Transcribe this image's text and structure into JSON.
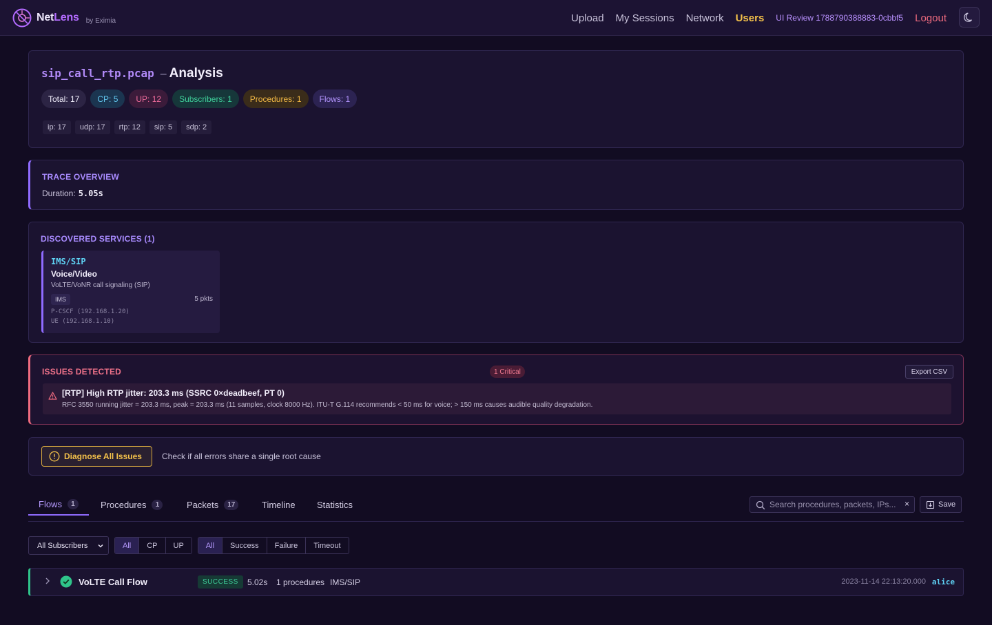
{
  "brand": {
    "name_part1": "Net",
    "name_part2": "Lens",
    "byline": "by Eximia"
  },
  "nav": {
    "links": [
      "Upload",
      "My Sessions",
      "Network",
      "Users"
    ],
    "active": "Users",
    "user": "UI Review 1788790388883-0cbbf5",
    "logout": "Logout",
    "theme_icon": "moon-icon"
  },
  "header": {
    "file_name": "sip_call_rtp.pcap",
    "separator": "–",
    "title_suffix": "Analysis",
    "chips": {
      "total": "Total: 17",
      "cp": "CP: 5",
      "up": "UP: 12",
      "subscribers": "Subscribers: 1",
      "procedures": "Procedures: 1",
      "flows": "Flows: 1"
    },
    "protocols": [
      "ip: 17",
      "udp: 17",
      "rtp: 12",
      "sip: 5",
      "sdp: 2"
    ]
  },
  "trace": {
    "title": "TRACE OVERVIEW",
    "duration_label": "Duration:",
    "duration_value": "5.05s"
  },
  "services": {
    "title": "DISCOVERED SERVICES (1)",
    "items": [
      {
        "name": "IMS/SIP",
        "type": "Voice/Video",
        "description": "VoLTE/VoNR call signaling (SIP)",
        "tag": "IMS",
        "packets": "5 pkts",
        "nodes": [
          "P-CSCF (192.168.1.20)",
          "UE (192.168.1.10)"
        ]
      }
    ]
  },
  "issues": {
    "title": "ISSUES DETECTED",
    "badge": "1 Critical",
    "export_label": "Export CSV",
    "items": [
      {
        "title": "[RTP] High RTP jitter: 203.3 ms (SSRC 0×deadbeef, PT 0)",
        "description": "RFC 3550 running jitter = 203.3 ms, peak = 203.3 ms (11 samples, clock 8000 Hz). ITU-T G.114 recommends < 50 ms for voice; > 150 ms causes audible quality degradation."
      }
    ]
  },
  "diagnose": {
    "button_label": "Diagnose All Issues",
    "hint": "Check if all errors share a single root cause"
  },
  "tabs": {
    "items": [
      {
        "label": "Flows",
        "count": "1"
      },
      {
        "label": "Procedures",
        "count": "1"
      },
      {
        "label": "Packets",
        "count": "17"
      },
      {
        "label": "Timeline",
        "count": ""
      },
      {
        "label": "Statistics",
        "count": ""
      }
    ],
    "active": "Flows",
    "search_placeholder": "Search procedures, packets, IPs...",
    "clear_label": "×",
    "save_label": "Save"
  },
  "filters": {
    "subscriber_select": "All Subscribers",
    "plane": [
      "All",
      "CP",
      "UP"
    ],
    "plane_active": "All",
    "status": [
      "All",
      "Success",
      "Failure",
      "Timeout"
    ],
    "status_active": "All"
  },
  "flows": [
    {
      "name": "VoLTE Call Flow",
      "status": "SUCCESS",
      "duration": "5.02s",
      "procedures": "1 procedures",
      "service": "IMS/SIP",
      "timestamp": "2023-11-14 22:13:20.000",
      "user": "alice"
    }
  ],
  "colors": {
    "background": "#120c22",
    "accent": "#8f6bff",
    "active_nav": "#f3c14a",
    "critical": "#ef6b7f",
    "success": "#2fc48a"
  }
}
